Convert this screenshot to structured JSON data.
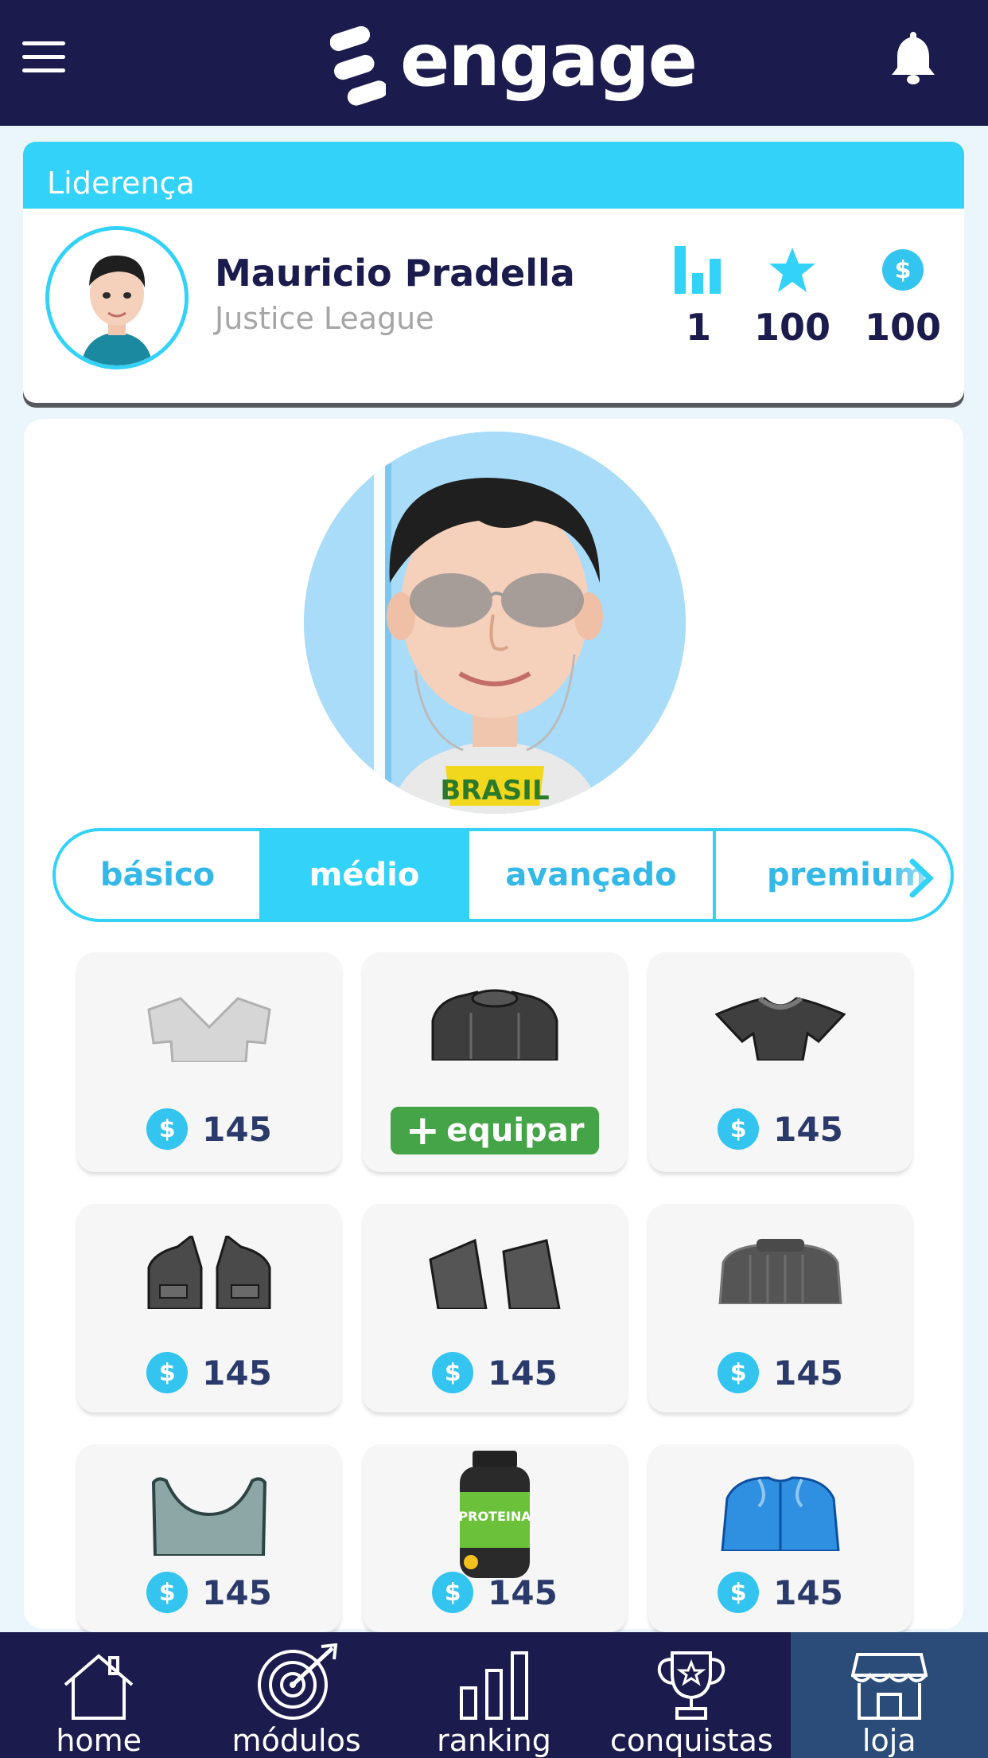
{
  "header": {
    "brand": "engage",
    "menu_icon": "hamburger-menu-icon",
    "notification_icon": "bell-icon"
  },
  "profile": {
    "section_title": "Liderença",
    "name": "Mauricio Pradella",
    "team": "Justice League",
    "stats": [
      {
        "icon": "ranking-bars-icon",
        "value": "1"
      },
      {
        "icon": "star-icon",
        "value": "100"
      },
      {
        "icon": "coin-icon",
        "value": "100"
      }
    ]
  },
  "store": {
    "tabs": [
      {
        "label": "básico",
        "active": false
      },
      {
        "label": "médio",
        "active": true
      },
      {
        "label": "avançado",
        "active": false
      },
      {
        "label": "premium",
        "active": false
      }
    ],
    "currency_symbol": "$",
    "equip_label": "equipar",
    "items": [
      {
        "name": "vneck-shirt",
        "price": "145",
        "owned": false
      },
      {
        "name": "dark-sweater",
        "price": null,
        "owned": true
      },
      {
        "name": "ruffled-top",
        "price": "145",
        "owned": false
      },
      {
        "name": "jacket-open",
        "price": "145",
        "owned": false
      },
      {
        "name": "blazer-open",
        "price": "145",
        "owned": false
      },
      {
        "name": "turtleneck",
        "price": "145",
        "owned": false
      },
      {
        "name": "crop-top",
        "price": "145",
        "owned": false
      },
      {
        "name": "protein-jar",
        "price": "145",
        "owned": false,
        "jar_label": "PROTEINA"
      },
      {
        "name": "blue-jacket",
        "price": "145",
        "owned": false
      }
    ]
  },
  "avatar": {
    "shirt_text": "BRASIL"
  },
  "bottom_nav": [
    {
      "label": "home",
      "icon": "house-icon",
      "active": false
    },
    {
      "label": "módulos",
      "icon": "target-icon",
      "active": false
    },
    {
      "label": "ranking",
      "icon": "ranking-bars-icon",
      "active": false
    },
    {
      "label": "conquistas",
      "icon": "trophy-icon",
      "active": false
    },
    {
      "label": "loja",
      "icon": "store-icon",
      "active": true
    }
  ],
  "colors": {
    "navy": "#1b1b4d",
    "accent": "#33d2f8",
    "equip_green": "#45a447",
    "nav_active": "#2b4c79"
  }
}
